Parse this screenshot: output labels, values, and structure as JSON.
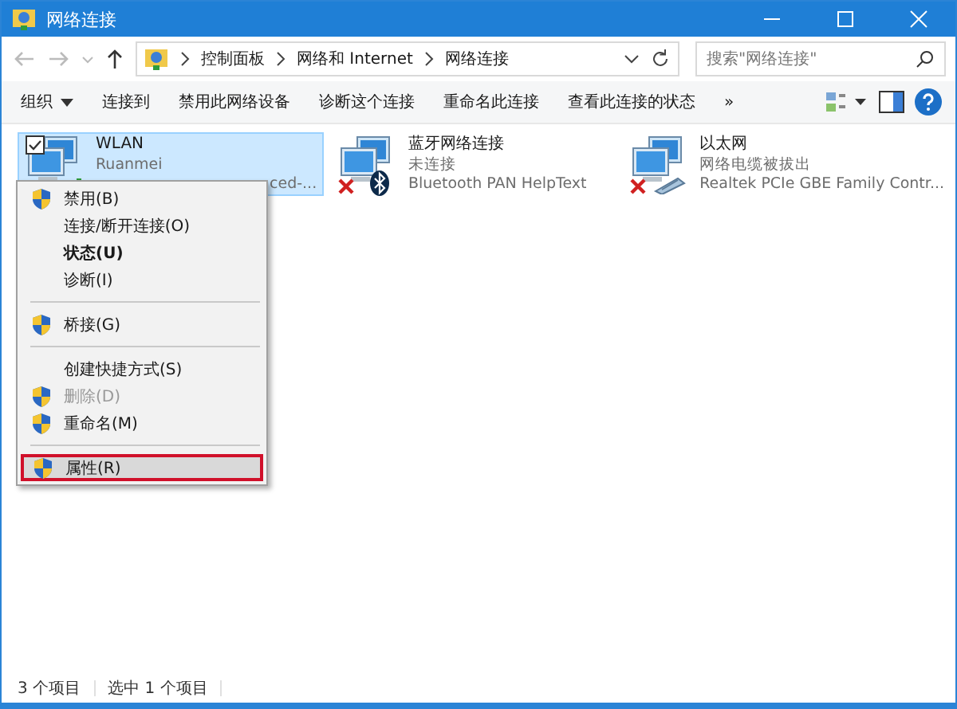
{
  "window": {
    "title": "网络连接"
  },
  "address": {
    "crumbs": [
      "控制面板",
      "网络和 Internet",
      "网络连接"
    ]
  },
  "search": {
    "placeholder": "搜索\"网络连接\""
  },
  "toolbar": {
    "items": [
      {
        "label": "组织",
        "dropdown": true
      },
      {
        "label": "连接到",
        "dropdown": false
      },
      {
        "label": "禁用此网络设备",
        "dropdown": false
      },
      {
        "label": "诊断这个连接",
        "dropdown": false
      },
      {
        "label": "重命名此连接",
        "dropdown": false
      },
      {
        "label": "查看此连接的状态",
        "dropdown": false
      }
    ],
    "more": "»"
  },
  "connections": [
    {
      "name": "WLAN",
      "status": "Ruanmei",
      "device": "ced-...",
      "selected": true,
      "checked": true,
      "kind": "wifi"
    },
    {
      "name": "蓝牙网络连接",
      "status": "未连接",
      "device": "Bluetooth PAN HelpText",
      "selected": false,
      "checked": false,
      "kind": "bluetooth"
    },
    {
      "name": "以太网",
      "status": "网络电缆被拔出",
      "device": "Realtek PCIe GBE Family Contr...",
      "selected": false,
      "checked": false,
      "kind": "ethernet"
    }
  ],
  "context_menu": [
    {
      "kind": "item",
      "label": "禁用(B)",
      "shield": true,
      "bold": false,
      "disabled": false,
      "selected": false
    },
    {
      "kind": "item",
      "label": "连接/断开连接(O)",
      "shield": false,
      "bold": false,
      "disabled": false,
      "selected": false
    },
    {
      "kind": "item",
      "label": "状态(U)",
      "shield": false,
      "bold": true,
      "disabled": false,
      "selected": false
    },
    {
      "kind": "item",
      "label": "诊断(I)",
      "shield": false,
      "bold": false,
      "disabled": false,
      "selected": false
    },
    {
      "kind": "separator"
    },
    {
      "kind": "item",
      "label": "桥接(G)",
      "shield": true,
      "bold": false,
      "disabled": false,
      "selected": false
    },
    {
      "kind": "separator"
    },
    {
      "kind": "item",
      "label": "创建快捷方式(S)",
      "shield": false,
      "bold": false,
      "disabled": false,
      "selected": false
    },
    {
      "kind": "item",
      "label": "删除(D)",
      "shield": true,
      "bold": false,
      "disabled": true,
      "selected": false
    },
    {
      "kind": "item",
      "label": "重命名(M)",
      "shield": true,
      "bold": false,
      "disabled": false,
      "selected": false
    },
    {
      "kind": "separator"
    },
    {
      "kind": "item",
      "label": "属性(R)",
      "shield": true,
      "bold": false,
      "disabled": false,
      "selected": true
    }
  ],
  "status_bar": [
    "3 个项目",
    "选中 1 个项目"
  ]
}
